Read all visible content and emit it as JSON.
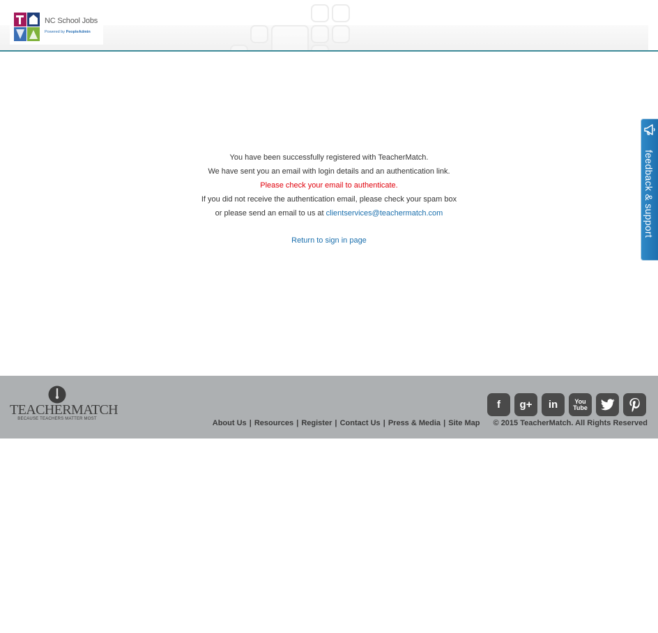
{
  "header": {
    "logo": {
      "title": "NC School Jobs",
      "powered_prefix": "Powered by ",
      "powered_brand": "PeopleAdmin"
    }
  },
  "message": {
    "line1": "You have been successfully registered with TeacherMatch.",
    "line2": "We have sent you an email with login details and an authentication link.",
    "line3": "Please check your email to authenticate.",
    "line4": "If you did not receive the authentication email, please check your spam box",
    "line5_prefix": "or please send an email to us at ",
    "email": "clientservices@teachermatch.com",
    "return_link": "Return to sign in page"
  },
  "feedback_tab": {
    "label": "feedback & support",
    "icon": "megaphone-icon"
  },
  "footer": {
    "brand": {
      "name": "TEACHERMATCH",
      "tagline": "BECAUSE TEACHERS MATTER MOST"
    },
    "social": [
      {
        "icon": "facebook-icon",
        "glyph": "f"
      },
      {
        "icon": "google-plus-icon",
        "glyph": "g+"
      },
      {
        "icon": "linkedin-icon",
        "glyph": "in"
      },
      {
        "icon": "youtube-icon",
        "glyph_top": "You",
        "glyph_bottom": "Tube"
      },
      {
        "icon": "twitter-icon"
      },
      {
        "icon": "pinterest-icon",
        "glyph": "P"
      }
    ],
    "links": [
      "About Us",
      "Resources",
      "Register",
      "Contact Us",
      "Press & Media",
      "Site Map"
    ],
    "separator": "|",
    "copyright": "© 2015 TeacherMatch. All Rights Reserved"
  },
  "colors": {
    "accent_rule": "#3d8a98",
    "alert_text": "#e0000b",
    "link": "#1a6fad",
    "footer_bg": "#adb0b2",
    "feedback_bg": "#2f8ac8"
  }
}
